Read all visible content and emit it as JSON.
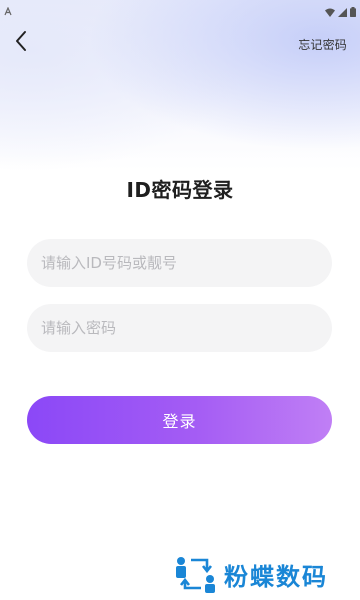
{
  "status_bar": {
    "left_icon": "a-notification-icon",
    "right_icons": [
      "wifi-icon",
      "cellular-signal-icon",
      "battery-icon"
    ]
  },
  "header": {
    "back_icon": "chevron-left-icon",
    "forgot_password_label": "忘记密码"
  },
  "page": {
    "title": "ID密码登录"
  },
  "form": {
    "id_field": {
      "placeholder": "请输入ID号码或靓号",
      "value": ""
    },
    "password_field": {
      "placeholder": "请输入密码",
      "value": ""
    },
    "login_label": "登录"
  },
  "watermark": {
    "text": "粉蝶数码",
    "logo_icon": "people-exchange-logo"
  },
  "colors": {
    "accent_start": "#8b48f7",
    "accent_end": "#c07ff5",
    "watermark": "#1a86d6",
    "input_bg": "#f4f4f5"
  }
}
